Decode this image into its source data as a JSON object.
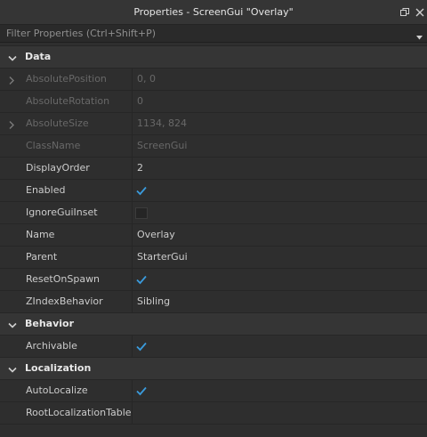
{
  "window": {
    "title": "Properties - ScreenGui \"Overlay\""
  },
  "filter": {
    "placeholder": "Filter Properties (Ctrl+Shift+P)"
  },
  "colors": {
    "accent": "#3a9bdc",
    "background": "#2e2e2e",
    "header": "#353535",
    "disabled_text": "#686868"
  },
  "sections": {
    "data": {
      "label": "Data",
      "rows": {
        "absolute_position": {
          "name": "AbsolutePosition",
          "value": "0, 0"
        },
        "absolute_rotation": {
          "name": "AbsoluteRotation",
          "value": "0"
        },
        "absolute_size": {
          "name": "AbsoluteSize",
          "value": "1134, 824"
        },
        "class_name": {
          "name": "ClassName",
          "value": "ScreenGui"
        },
        "display_order": {
          "name": "DisplayOrder",
          "value": "2"
        },
        "enabled": {
          "name": "Enabled",
          "checked": true
        },
        "ignore_gui_inset": {
          "name": "IgnoreGuiInset",
          "checked": false
        },
        "name": {
          "name": "Name",
          "value": "Overlay"
        },
        "parent": {
          "name": "Parent",
          "value": "StarterGui"
        },
        "reset_on_spawn": {
          "name": "ResetOnSpawn",
          "checked": true
        },
        "zindex_behavior": {
          "name": "ZIndexBehavior",
          "value": "Sibling"
        }
      }
    },
    "behavior": {
      "label": "Behavior",
      "rows": {
        "archivable": {
          "name": "Archivable",
          "checked": true
        }
      }
    },
    "localization": {
      "label": "Localization",
      "rows": {
        "auto_localize": {
          "name": "AutoLocalize",
          "checked": true
        },
        "root_localization_table": {
          "name": "RootLocalizationTable",
          "value": ""
        }
      }
    }
  }
}
